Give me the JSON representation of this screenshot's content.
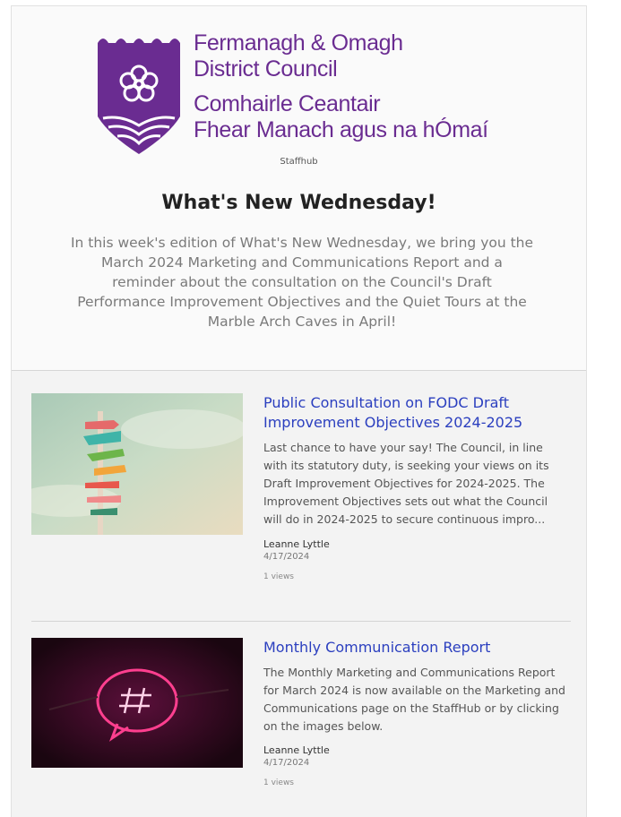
{
  "brand": {
    "name_line1": "Fermanagh & Omagh",
    "name_line2": "District Council",
    "irish_line1": "Comhairle Ceantair",
    "irish_line2": "Fhear Manach agus na hÓmaí",
    "site": "Staffhub",
    "color": "#6a2c91"
  },
  "newsletter": {
    "title": "What's New Wednesday!",
    "intro": "In this week's edition of What's New Wednesday, we bring you the March 2024 Marketing and Communications Report and a reminder about the consultation on the Council's Draft Performance Improvement Objectives and the Quiet Tours at the Marble Arch Caves in April!"
  },
  "articles": [
    {
      "title": "Public Consultation on FODC Draft Improvement Objectives 2024-2025",
      "description": "Last chance to have your say! The Council, in line with its statutory duty, is seeking your views on its Draft Improvement Objectives for 2024-2025. The Improvement Objectives sets out what the Council will do in 2024-2025 to secure continuous impro...",
      "author": "Leanne Lyttle",
      "date": "4/17/2024",
      "views": "1 views",
      "image": "signpost-image"
    },
    {
      "title": "Monthly Communication Report",
      "description": "The Monthly Marketing and Communications Report for March 2024 is now available on the Marketing and Communications page on the StaffHub or by clicking on the images below.",
      "author": "Leanne Lyttle",
      "date": "4/17/2024",
      "views": "1 views",
      "image": "neon-hashtag-image"
    }
  ],
  "colors": {
    "link": "#2b3fbf",
    "accent": "#6a2c91"
  }
}
